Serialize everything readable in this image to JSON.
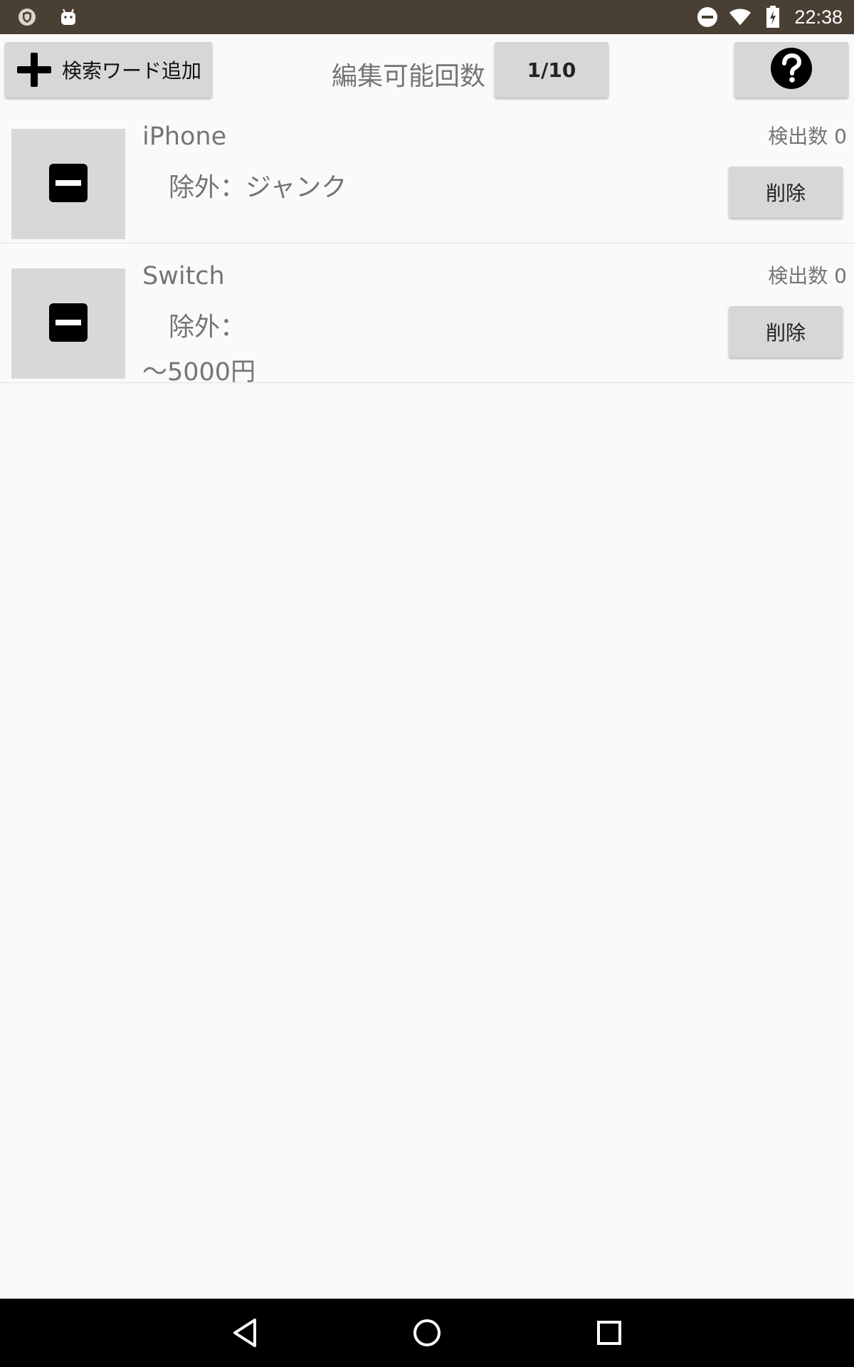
{
  "status_bar": {
    "time": "22:38",
    "icons": [
      "shield-icon",
      "android-icon",
      "do-not-disturb-icon",
      "wifi-icon",
      "battery-charging-icon"
    ]
  },
  "toolbar": {
    "add_label": "検索ワード追加",
    "edit_count_label": "編集可能回数",
    "edit_count_value": "1/10",
    "help_icon": "question-circle-icon"
  },
  "items": [
    {
      "title": "iPhone",
      "exclude": "除外：ジャンク",
      "price": "",
      "detect_label": "検出数 0",
      "delete_label": "削除"
    },
    {
      "title": "Switch",
      "exclude": "除外：",
      "price": "〜5000円",
      "detect_label": "検出数 0",
      "delete_label": "削除"
    }
  ],
  "nav": {
    "icons": [
      "back-icon",
      "home-icon",
      "recents-icon"
    ]
  }
}
